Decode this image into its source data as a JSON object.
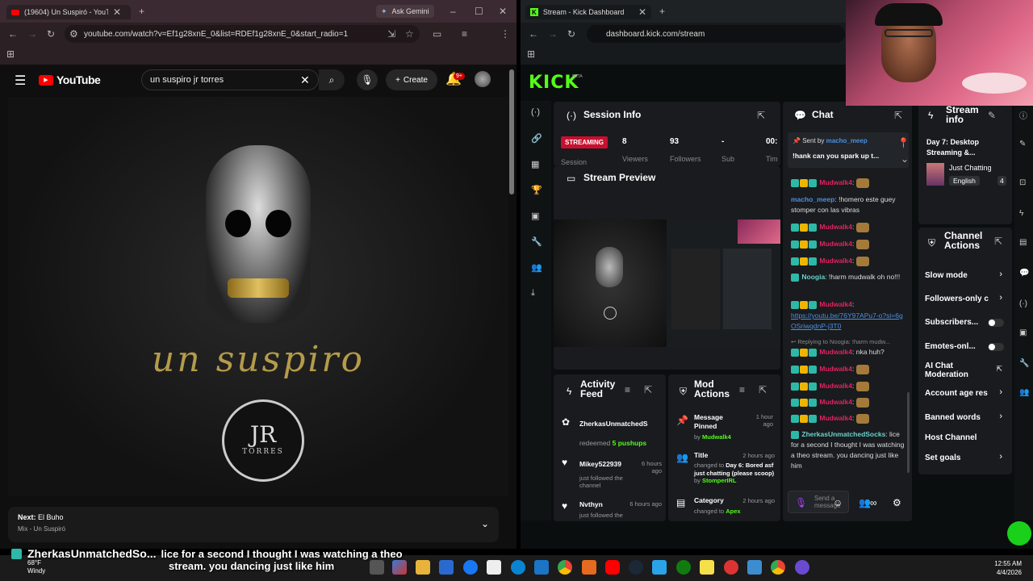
{
  "youtube_window": {
    "tab_title": "(19604) Un Suspiró - YouTube",
    "ask_gemini": "Ask Gemini",
    "url": "youtube.com/watch?v=Ef1g28xnE_0&list=RDEf1g28xnE_0&start_radio=1",
    "logo_text": "YouTube",
    "search_value": "un suspiro jr torres",
    "create_label": "Create",
    "notif_count": "9+",
    "video_art_title": "un suspiro",
    "jr_big": "JR",
    "jr_small": "TORRES",
    "next_label": "Next:",
    "next_title": "El Buho",
    "next_sub": "Mix - Un Suspiró"
  },
  "kick_window": {
    "tab_title": "Stream - Kick Dashboard",
    "url": "dashboard.kick.com/stream",
    "logo": "KICK",
    "beta": "BETA",
    "session_info": {
      "title": "Session Info",
      "live_badge": "STREAMING",
      "viewers": "8",
      "viewers_label": "Viewers",
      "followers": "93",
      "followers_label": "Followers",
      "sub": "-",
      "sub_label": "Sub",
      "time": "00:",
      "time_label": "Tim",
      "session_label": "Session"
    },
    "stream_preview": {
      "title": "Stream Preview"
    },
    "activity_feed": {
      "title_1": "Activity",
      "title_2": "Feed",
      "items": [
        {
          "user": "ZherkasUnmatchedS",
          "action": "redeemed",
          "detail": "5 pushups",
          "time": ""
        },
        {
          "user": "Mikey522939",
          "action": "just followed the channel",
          "time": "6 hours ago"
        },
        {
          "user": "Nvthyn",
          "action": "just followed the",
          "time": "6 hours ago"
        }
      ]
    },
    "mod_actions": {
      "title_1": "Mod",
      "title_2": "Actions",
      "items": [
        {
          "title": "Message Pinned",
          "by_label": "by",
          "by": "Mudwalk4",
          "time": "1 hour ago"
        },
        {
          "title": "Title",
          "detail_prefix": "changed to",
          "detail": "Day 6: Bored asf just chatting (please scoop)",
          "by_label": "by",
          "by": "StomperIRL",
          "time": "2 hours ago"
        },
        {
          "title": "Category",
          "detail_prefix": "changed to",
          "detail": "Apex",
          "time": "2 hours ago"
        }
      ]
    },
    "chat": {
      "title": "Chat",
      "pinned_label": "Sent by",
      "pinned_user": "macho_meep",
      "pinned_text": "!hank can you spark up t...",
      "messages": [
        {
          "user": "Mudwalk4",
          "text": ""
        },
        {
          "user": "macho_meep",
          "text": "!homero este guey stomper con las vibras"
        },
        {
          "user": "Mudwalk4",
          "text": ""
        },
        {
          "user": "Mudwalk4",
          "text": ""
        },
        {
          "user": "Mudwalk4",
          "text": ""
        },
        {
          "user": "Noogia",
          "text": "!harm mudwalk oh no!!!"
        },
        {
          "user": "Mudwalk4",
          "text": ""
        },
        {
          "link": "https://youtu.be/76Y97APu7-o?si=6gOSriwqdnP-j3T0"
        },
        {
          "reply": "Replying to Noogia: !harm mudw..."
        },
        {
          "user": "Mudwalk4",
          "text": "nka huh?"
        },
        {
          "user": "Mudwalk4",
          "text": ""
        },
        {
          "user": "Mudwalk4",
          "text": ""
        },
        {
          "user": "Mudwalk4",
          "text": ""
        },
        {
          "user": "Mudwalk4",
          "text": ""
        },
        {
          "user": "ZherkasUnmatchedSocks",
          "text": "lice for a second I thought I was watching a theo stream. you dancing just like him"
        }
      ],
      "send_placeholder": "Send a message"
    },
    "stream_info": {
      "title_1": "Stream",
      "title_2": "info",
      "stream_title": "Day 7: Desktop Streaming &...",
      "category": "Just Chatting",
      "language": "English",
      "extra": "4"
    },
    "channel_actions": {
      "title_1": "Channel",
      "title_2": "Actions",
      "items": [
        {
          "label": "Slow mode",
          "type": "chevron"
        },
        {
          "label": "Followers-only c",
          "type": "chevron"
        },
        {
          "label": "Subscribers...",
          "type": "toggle"
        },
        {
          "label": "Emotes-onl...",
          "type": "toggle"
        },
        {
          "label": "AI Chat Moderation",
          "type": "external"
        },
        {
          "label": "Account age res",
          "type": "chevron"
        },
        {
          "label": "Banned words",
          "type": "chevron"
        },
        {
          "label": "Host Channel",
          "type": "none"
        },
        {
          "label": "Set goals",
          "type": "chevron"
        }
      ]
    }
  },
  "overlay": {
    "username": "ZherkasUnmatchedSo...",
    "message_line1": "lice for a second I thought I was watching a theo",
    "message_line2": "stream. you dancing just like him"
  },
  "taskbar": {
    "weather_temp": "68°F",
    "weather_desc": "Windy",
    "time": "12:55 AM",
    "date": "4/4/2026"
  },
  "colors": {
    "kick_green": "#53fc18",
    "youtube_red": "#ff0000",
    "live_red": "#c8102e"
  }
}
